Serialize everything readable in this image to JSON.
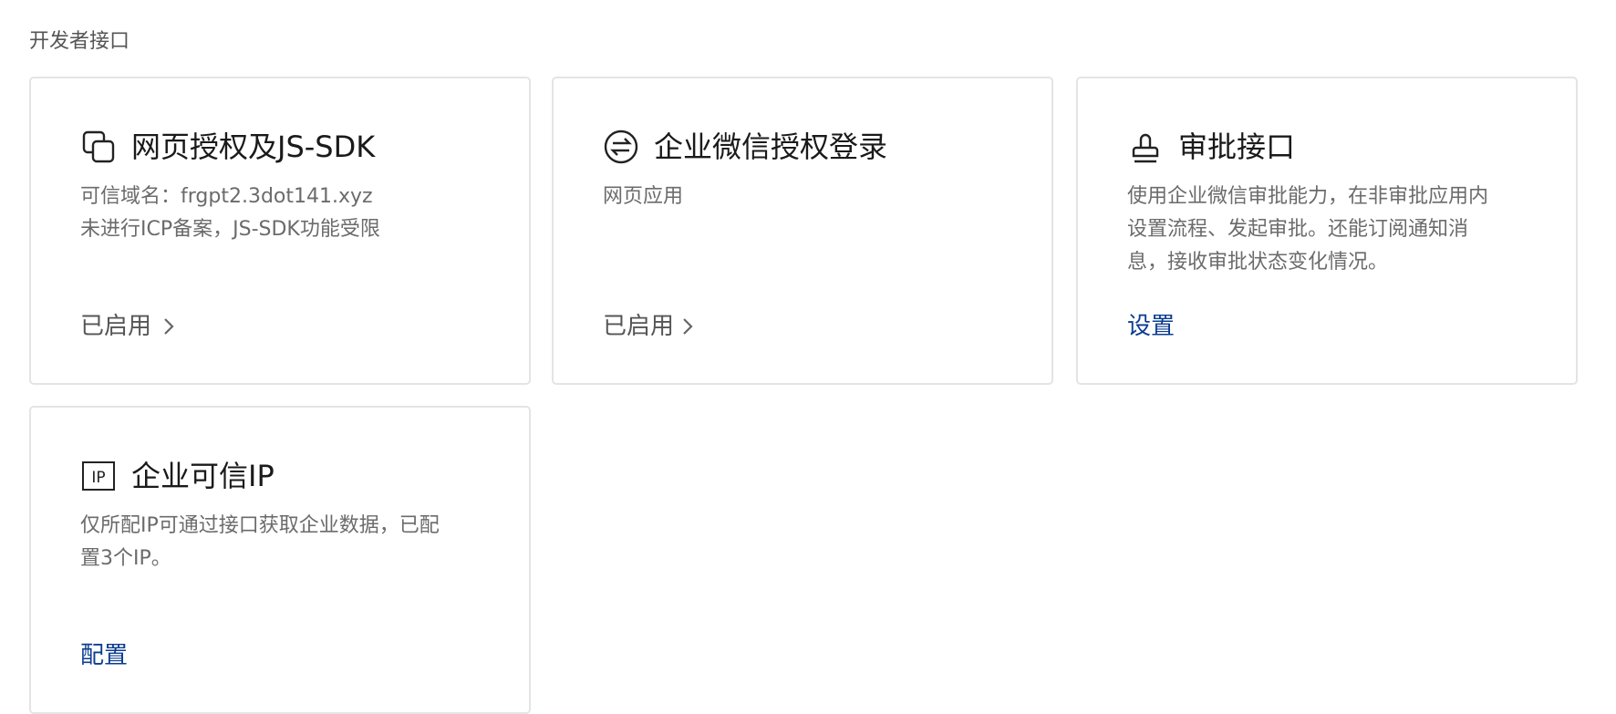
{
  "section": {
    "title": "开发者接口"
  },
  "cards": [
    {
      "icon": "web-auth-icon",
      "title": "网页授权及JS-SDK",
      "desc": [
        "可信域名：frgpt2.3dot141.xyz",
        "未进行ICP备案，JS-SDK功能受限"
      ],
      "action": "已启用"
    },
    {
      "icon": "exchange-icon",
      "title": "企业微信授权登录",
      "desc": [
        "网页应用"
      ],
      "action": "已启用"
    },
    {
      "icon": "stamp-icon",
      "title": "审批接口",
      "desc": [
        "使用企业微信审批能力，在非审批应用内",
        "设置流程、发起审批。还能订阅通知消",
        "息，接收审批状态变化情况。"
      ],
      "action": "设置"
    },
    {
      "icon": "ip-icon",
      "icon_text": "IP",
      "title": "企业可信IP",
      "desc": [
        "仅所配IP可通过接口获取企业数据，已配",
        "置3个IP。"
      ],
      "action": "配置"
    }
  ]
}
